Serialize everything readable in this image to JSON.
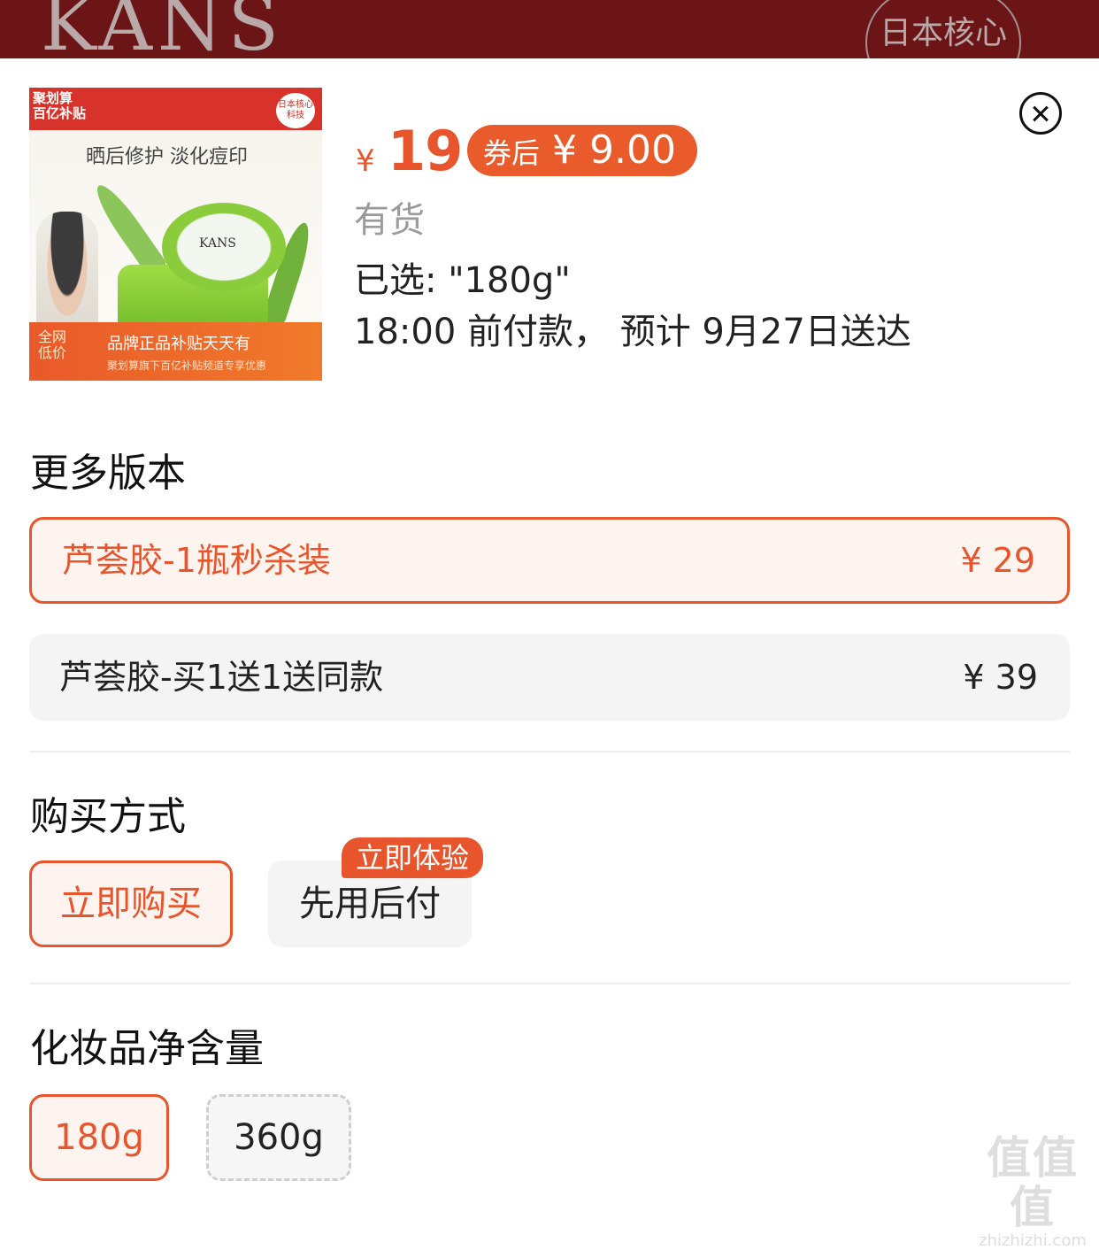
{
  "banner": {
    "logo": "KANS",
    "seal": "日本核心"
  },
  "product_image": {
    "promo_line1": "聚划算",
    "promo_line2": "百亿补贴",
    "badge_line1": "日本核心",
    "badge_line2": "科技",
    "slogan": "晒后修护 淡化痘印",
    "jar_brand": "KANS",
    "bottom_left_1": "全网",
    "bottom_left_2": "低价",
    "bottom_main": "品牌正品补贴天天有",
    "bottom_sub": "聚划算旗下百亿补贴频道专享优惠"
  },
  "price": {
    "currency": "¥",
    "value": "19",
    "coupon_label": "券后",
    "coupon_price": "¥ 9.00"
  },
  "stock_status": "有货",
  "selected_text": "已选: \"180g\"",
  "delivery_text": "18:00 前付款， 预计 9月27日送达",
  "more_versions": {
    "title": "更多版本",
    "items": [
      {
        "name": "芦荟胶-1瓶秒杀装",
        "price": "¥ 29",
        "selected": true
      },
      {
        "name": "芦荟胶-买1送1送同款",
        "price": "¥ 39",
        "selected": false
      }
    ]
  },
  "purchase_method": {
    "title": "购买方式",
    "options": [
      {
        "label": "立即购买",
        "selected": true
      },
      {
        "label": "先用后付",
        "selected": false,
        "tag": "立即体验"
      }
    ]
  },
  "net_content": {
    "title": "化妆品净含量",
    "options": [
      {
        "label": "180g",
        "selected": true
      },
      {
        "label": "360g",
        "selected": false
      }
    ]
  },
  "watermark": {
    "line1": "值值值",
    "line2": "zhizhizhi.com"
  },
  "colors": {
    "accent": "#e8552c",
    "banner": "#6b1517",
    "selected_bg": "#fdf3ef",
    "chip_bg": "#f4f4f4"
  }
}
